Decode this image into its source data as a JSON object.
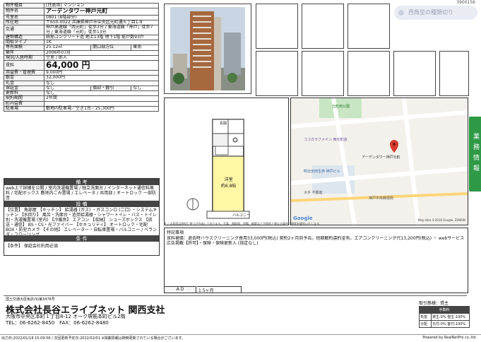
{
  "doc_id": "3900156",
  "notification": {
    "text": "西角型の種類切り"
  },
  "sidebar_tab": "業務情報",
  "property": {
    "rows": [
      {
        "label": "物件種目",
        "value": "[住居用] マンション"
      },
      {
        "label": "物件名",
        "value": "アーデンタワー神戸元町"
      },
      {
        "label": "号室名",
        "value": "0801 (8階部分)"
      },
      {
        "label": "所在地",
        "value": "〒650-0022 兵庫県神戸市中央区元町通６丁目1-9"
      },
      {
        "label": "交通",
        "value": "神戸高速線「西元町」徒歩3分 / 東海道線「神戸」徒歩7分 / 東海道線「元町」徒歩13分"
      },
      {
        "label": "建物構造",
        "value": "鉄筋コンクリート造 地上13階 地下1階 総戸数93戸"
      },
      {
        "label": "間取タイプ",
        "value": "1K"
      },
      {
        "label": "専有面積",
        "value": "25.12㎡",
        "label2": "開口部方位",
        "value2": "東南"
      },
      {
        "label": "築年",
        "value": "2006年07月"
      },
      {
        "label": "現況/入居時期",
        "value": "空室 / 即入"
      },
      {
        "label": "賃料",
        "value": "64,000 円"
      },
      {
        "label": "共益費・管理費",
        "value": "9,000円"
      },
      {
        "label": "敷金",
        "value": "32,000円"
      },
      {
        "label": "礼金",
        "value": "なし"
      },
      {
        "label": "保証金",
        "value": "なし",
        "label2": "償却・敷引",
        "value2": "なし"
      },
      {
        "label": "更新料",
        "value": "なし"
      },
      {
        "label": "契約期間",
        "value": "2年間"
      },
      {
        "label": "町内会費",
        "value": ""
      },
      {
        "label": "駐車場",
        "value": "敷地内駐車場／空き1台／25,300円"
      }
    ],
    "remarks_head": "備 考",
    "remarks": "web上で詳細を公開 / 室内洗濯機置場 / 独立洗面台 / インターネット通信料無料 / 宅配ボックス 敷地内ごみ置場 / エレベータ / 共用部 / オートロック 一部防音",
    "equipment_head": "設 備",
    "equipment": "【位置】 角部屋 【キッチン】 給湯器 (ガス) ・ガスコンロ (二口) ・システムキッチン 【水回り】 風呂・洗面台・追焚給湯器・シャワートイレ・バス・トイレ別・洗濯機置場 (室内) 【冷暖房】 エアコン 【収納】 シューズボックス 【放送・通信】 BS・CS・光ファイバー 【セキュリティ】 オートロック・宅配BOX・防犯カメラ 【その他】 エレベーター・自転車置場・バルコニー / ベランダ・フローリング",
    "conditions_head": "条 件",
    "conditions": "【条件】 保証会社利用必須"
  },
  "floorplan": {
    "rooms": [
      "洋室 約6.8帖",
      "玄関",
      "洗",
      "浴",
      "冷",
      "MB",
      "バルコニー"
    ],
    "room_texts": {
      "room": "洋室",
      "size": "約6.8帖",
      "balcony": "バルコニー"
    }
  },
  "map": {
    "labels": [
      "元町南公園",
      "ココカラファイン 西元町店",
      "アーデンタワー神戸元町",
      "明治安田生命 神戸ビル",
      "大手 不動産",
      "神戸中央郵便局",
      "Google",
      "Map data ©2018 Google, ZENRIN"
    ]
  },
  "info": {
    "title": "特記事項",
    "text": "賃料補償：退去時ハウスクリーニング費用33,000円(税込) 契約2ヶ月前予告。短期解約違約金有。エアコンクリーニング代13,200円(税込) ・ webサービス広告掲載【許可】・保険・保険更新入 (指定なし)",
    "ad_label": "A D",
    "ad_value": "1.5ヶ月",
    "note": "※ この図面は現状に基づき作成してあります。写真、間取図、設備、概要などが現状と異なる場合は現状を優先いたします。"
  },
  "company": {
    "license": "国土交通大臣免許(9)第3476号",
    "name": "株式会社長谷エライブネット 関西支社",
    "address": "大阪市中央区本町１丁目8-12 オーク堺筋本町ビル2階",
    "tel": "TEL：06-6262-8450　FAX：06-6262-8480"
  },
  "trade": {
    "title": "取引態様：貸主",
    "fee_label": "手数料",
    "burden_label": "負担",
    "burden_value": "貸主:0% 借主:100%",
    "split_label": "分配",
    "split_value": "元付:0% 客付:100%"
  },
  "footer": {
    "left": "出力日:2022/01/18 15:09:56 / 次回更新予定日:2022/02/01 ※掲載情報は随時更新されている場合がございます。",
    "right": "Powered by RealNetPro co.,ltd."
  }
}
